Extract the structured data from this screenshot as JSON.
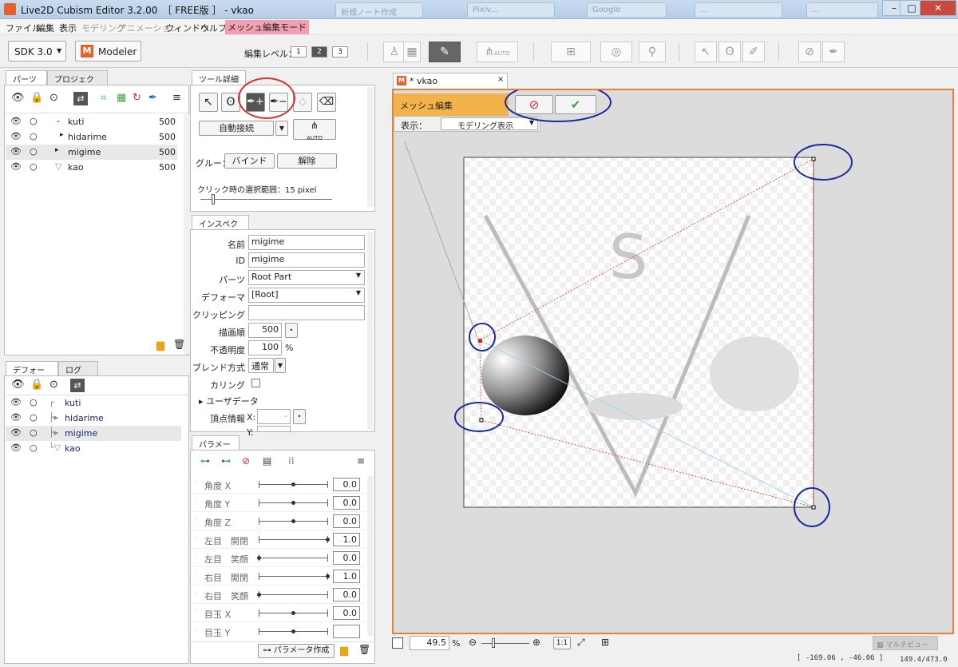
{
  "window": {
    "title": "Live2D Cubism Editor 3.2.00　［ FREE版 ］ - vkao",
    "bg_tabs": [
      "新規ノート作成",
      "Pixiv...",
      "Google",
      "...",
      "..."
    ]
  },
  "menu": {
    "items": [
      "ファイル",
      "編集",
      "表示",
      "モデリング",
      "アニメーション",
      "ウィンドウ",
      "ヘルプ"
    ],
    "mesh_mode": "メッシュ編集モード"
  },
  "toolbar": {
    "sdk": "SDK 3.0",
    "modeler": "Modeler",
    "edit_level_label": "編集レベル：",
    "levels": [
      "1",
      "2",
      "3"
    ],
    "auto_label": "AUTO"
  },
  "parts_panel": {
    "tabs": [
      "パーツ",
      "プロジェクト"
    ],
    "rows": [
      {
        "name": "kuti",
        "value": "500"
      },
      {
        "name": "hidarime",
        "value": "500"
      },
      {
        "name": "migime",
        "value": "500"
      },
      {
        "name": "kao",
        "value": "500"
      }
    ]
  },
  "deformer_panel": {
    "tabs": [
      "デフォーマ",
      "ログ"
    ],
    "rows": [
      "kuti",
      "hidarime",
      "migime",
      "kao"
    ]
  },
  "tool_detail": {
    "tab": "ツール詳細",
    "auto_connect": "自動接続",
    "glue_label": "グルー：",
    "bind": "バインド",
    "release": "解除",
    "click_range": "クリック時の選択範囲：15 pixel",
    "auto_label": "AUTO"
  },
  "inspector": {
    "tab": "インスペクタ",
    "name_label": "名前",
    "name_value": "migime",
    "id_label": "ID",
    "id_value": "migime",
    "part_label": "パーツ",
    "part_value": "Root Part",
    "deformer_label": "デフォーマ",
    "deformer_value": "[Root]",
    "clipping_label": "クリッピング",
    "draw_order_label": "描画順",
    "draw_order_value": "500",
    "opacity_label": "不透明度",
    "opacity_value": "100",
    "opacity_unit": "%",
    "blend_label": "ブレンド方式",
    "blend_value": "通常",
    "culling_label": "カリング",
    "user_data": "▸ ユーザデータ",
    "vertex_label": "頂点情報",
    "vx_label": "X:",
    "vy_label": "Y:",
    "vx_value": "-"
  },
  "params": {
    "tab": "パラメータ",
    "create_button": "パラメータ作成",
    "rows": [
      {
        "name": "角度 X",
        "value": "0.0",
        "pos": 0.5
      },
      {
        "name": "角度 Y",
        "value": "0.0",
        "pos": 0.5
      },
      {
        "name": "角度 Z",
        "value": "0.0",
        "pos": 0.5
      },
      {
        "name": "左目　開閉",
        "value": "1.0",
        "pos": 1.0
      },
      {
        "name": "左目　笑顔",
        "value": "0.0",
        "pos": 0.0
      },
      {
        "name": "右目　開閉",
        "value": "1.0",
        "pos": 1.0
      },
      {
        "name": "右目　笑顔",
        "value": "0.0",
        "pos": 0.0
      },
      {
        "name": "目玉 X",
        "value": "0.0",
        "pos": 0.5
      },
      {
        "name": "目玉 Y",
        "value": "",
        "pos": 0.5
      }
    ]
  },
  "viewport": {
    "tab_title": "* vkao",
    "mesh_edit": "メッシュ編集",
    "display_label": "表示：",
    "display_value": "モデリング表示",
    "canvas_letter": "S",
    "zoom": "49.5",
    "zoom_unit": "%",
    "ratio_btn": "1:1",
    "multiview": "マルチビュー"
  },
  "status": {
    "coords": "[ -169.06 ,  -46.06 ]",
    "size": "149.4/473.0"
  },
  "colors": {
    "accent_orange": "#e8803a",
    "mesh_mode_pink": "#f39fb0",
    "mesh_header": "#f4b34a",
    "annotation_red": "#d93030",
    "annotation_blue": "#1d2a9e"
  }
}
